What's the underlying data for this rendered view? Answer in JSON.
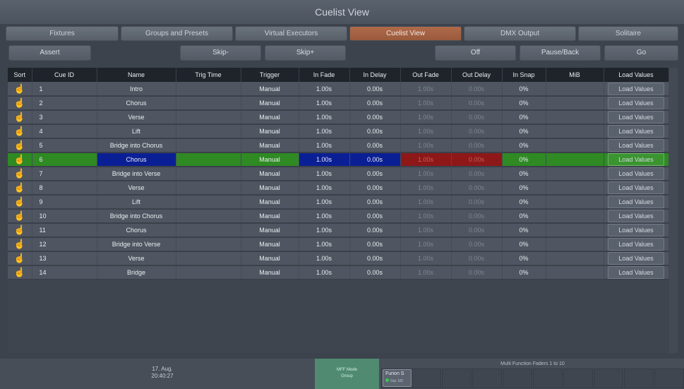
{
  "window": {
    "title": "Cuelist View"
  },
  "tabs": [
    {
      "label": "Fixtures"
    },
    {
      "label": "Groups and Presets"
    },
    {
      "label": "Virtual Executors"
    },
    {
      "label": "Cuelist View",
      "active": true
    },
    {
      "label": "DMX Output"
    },
    {
      "label": "Solitaire"
    }
  ],
  "controls": {
    "assert": "Assert",
    "skip_minus": "Skip-",
    "skip_plus": "Skip+",
    "off": "Off",
    "pause_back": "Pause/Back",
    "go": "Go"
  },
  "table": {
    "headers": [
      "Sort",
      "Cue ID",
      "Name",
      "Trig Time",
      "Trigger",
      "In Fade",
      "In Delay",
      "Out Fade",
      "Out Delay",
      "In Snap",
      "MiB",
      "Load Values"
    ],
    "rows": [
      {
        "id": "1",
        "name": "Intro",
        "trig_time": "",
        "trigger": "Manual",
        "in_fade": "1.00s",
        "in_delay": "0.00s",
        "out_fade": "1.00s",
        "out_delay": "0.00s",
        "in_snap": "0%",
        "mib": "",
        "load": "Load Values"
      },
      {
        "id": "2",
        "name": "Chorus",
        "trig_time": "",
        "trigger": "Manual",
        "in_fade": "1.00s",
        "in_delay": "0.00s",
        "out_fade": "1.00s",
        "out_delay": "0.00s",
        "in_snap": "0%",
        "mib": "",
        "load": "Load Values"
      },
      {
        "id": "3",
        "name": "Verse",
        "trig_time": "",
        "trigger": "Manual",
        "in_fade": "1.00s",
        "in_delay": "0.00s",
        "out_fade": "1.00s",
        "out_delay": "0.00s",
        "in_snap": "0%",
        "mib": "",
        "load": "Load Values"
      },
      {
        "id": "4",
        "name": "Lift",
        "trig_time": "",
        "trigger": "Manual",
        "in_fade": "1.00s",
        "in_delay": "0.00s",
        "out_fade": "1.00s",
        "out_delay": "0.00s",
        "in_snap": "0%",
        "mib": "",
        "load": "Load Values"
      },
      {
        "id": "5",
        "name": "Bridge into Chorus",
        "trig_time": "",
        "trigger": "Manual",
        "in_fade": "1.00s",
        "in_delay": "0.00s",
        "out_fade": "1.00s",
        "out_delay": "0.00s",
        "in_snap": "0%",
        "mib": "",
        "load": "Load Values"
      },
      {
        "id": "6",
        "name": "Chorus",
        "trig_time": "",
        "trigger": "Manual",
        "in_fade": "1.00s",
        "in_delay": "0.00s",
        "out_fade": "1.00s",
        "out_delay": "0.00s",
        "in_snap": "0%",
        "mib": "",
        "load": "Load Values",
        "active": true
      },
      {
        "id": "7",
        "name": "Bridge into Verse",
        "trig_time": "",
        "trigger": "Manual",
        "in_fade": "1.00s",
        "in_delay": "0.00s",
        "out_fade": "1.00s",
        "out_delay": "0.00s",
        "in_snap": "0%",
        "mib": "",
        "load": "Load Values"
      },
      {
        "id": "8",
        "name": "Verse",
        "trig_time": "",
        "trigger": "Manual",
        "in_fade": "1.00s",
        "in_delay": "0.00s",
        "out_fade": "1.00s",
        "out_delay": "0.00s",
        "in_snap": "0%",
        "mib": "",
        "load": "Load Values"
      },
      {
        "id": "9",
        "name": "Lift",
        "trig_time": "",
        "trigger": "Manual",
        "in_fade": "1.00s",
        "in_delay": "0.00s",
        "out_fade": "1.00s",
        "out_delay": "0.00s",
        "in_snap": "0%",
        "mib": "",
        "load": "Load Values"
      },
      {
        "id": "10",
        "name": "Bridge into Chorus",
        "trig_time": "",
        "trigger": "Manual",
        "in_fade": "1.00s",
        "in_delay": "0.00s",
        "out_fade": "1.00s",
        "out_delay": "0.00s",
        "in_snap": "0%",
        "mib": "",
        "load": "Load Values"
      },
      {
        "id": "11",
        "name": "Chorus",
        "trig_time": "",
        "trigger": "Manual",
        "in_fade": "1.00s",
        "in_delay": "0.00s",
        "out_fade": "1.00s",
        "out_delay": "0.00s",
        "in_snap": "0%",
        "mib": "",
        "load": "Load Values"
      },
      {
        "id": "12",
        "name": "Bridge into Verse",
        "trig_time": "",
        "trigger": "Manual",
        "in_fade": "1.00s",
        "in_delay": "0.00s",
        "out_fade": "1.00s",
        "out_delay": "0.00s",
        "in_snap": "0%",
        "mib": "",
        "load": "Load Values"
      },
      {
        "id": "13",
        "name": "Verse",
        "trig_time": "",
        "trigger": "Manual",
        "in_fade": "1.00s",
        "in_delay": "0.00s",
        "out_fade": "1.00s",
        "out_delay": "0.00s",
        "in_snap": "0%",
        "mib": "",
        "load": "Load Values"
      },
      {
        "id": "14",
        "name": "Bridge",
        "trig_time": "",
        "trigger": "Manual",
        "in_fade": "1.00s",
        "in_delay": "0.00s",
        "out_fade": "1.00s",
        "out_delay": "0.00s",
        "in_snap": "0%",
        "mib": "",
        "load": "Load Values"
      }
    ]
  },
  "footer": {
    "date": "17. Aug.",
    "time": "20:40:27",
    "mff_mode_label": "MFF Mode",
    "mff_mode_value": "Group",
    "faders_label": "Multi Function Faders 1 to 10",
    "fader1_name": "Furion S",
    "fader1_sub": "Grp 100"
  },
  "colors": {
    "active_row": "#2f8a24",
    "active_tab": "#b06a4a",
    "highlight_blue": "#0b1f95",
    "highlight_red": "#8e1818",
    "sort_icon": "#f2c53a"
  },
  "icons": {
    "sort": "hand-pointer-icon"
  }
}
